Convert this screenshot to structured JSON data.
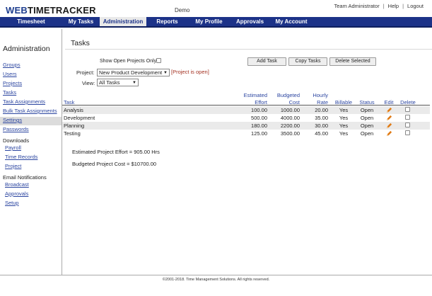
{
  "header": {
    "logo_web": "WEB",
    "logo_rest": "TIMETRACKER",
    "demo": "Demo",
    "links": [
      "Team Administrator",
      "Help",
      "Logout"
    ],
    "separator": "|"
  },
  "nav": {
    "tabs": [
      {
        "label": "Timesheet",
        "active": false
      },
      {
        "label": "My Tasks",
        "active": false
      },
      {
        "label": "Administration",
        "active": true
      },
      {
        "label": "Reports",
        "active": false
      },
      {
        "label": "My Profile",
        "active": false
      },
      {
        "label": "Approvals",
        "active": false
      },
      {
        "label": "My Account",
        "active": false
      }
    ]
  },
  "sidebar": {
    "title": "Administration",
    "items": [
      "Groups",
      "Users",
      "Projects",
      "Tasks",
      "Task Assignments",
      "Bulk Task Assignments",
      "Settings",
      "Passwords"
    ],
    "active": "Tasks",
    "downloads_heading": "Downloads",
    "downloads": [
      "Payroll",
      "Time Records",
      "Project"
    ],
    "email_heading": "Email Notifications",
    "email": [
      "Broadcast",
      "Approvals",
      "Setup"
    ]
  },
  "main": {
    "title": "Tasks",
    "show_open_label": "Show Open Projects Only:",
    "buttons": {
      "add": "Add Task",
      "copy": "Copy Tasks",
      "delete": "Delete Selected"
    },
    "project_label": "Project:",
    "project_value": "New Product Development",
    "project_status": "[Project is open]",
    "view_label": "View:",
    "view_value": "All Tasks"
  },
  "table": {
    "headers": {
      "task": "Task",
      "effort_1": "Estimated",
      "effort_2": "Effort",
      "cost_1": "Budgeted",
      "cost_2": "Cost",
      "rate_1": "Hourly",
      "rate_2": "Rate",
      "billable": "Billable",
      "status": "Status",
      "edit": "Edit",
      "delete": "Delete"
    },
    "rows": [
      {
        "task": "Analysis",
        "effort": "100.00",
        "cost": "1000.00",
        "rate": "20.00",
        "billable": "Yes",
        "status": "Open"
      },
      {
        "task": "Development",
        "effort": "500.00",
        "cost": "4000.00",
        "rate": "35.00",
        "billable": "Yes",
        "status": "Open"
      },
      {
        "task": "Planning",
        "effort": "180.00",
        "cost": "2200.00",
        "rate": "30.00",
        "billable": "Yes",
        "status": "Open"
      },
      {
        "task": "Testing",
        "effort": "125.00",
        "cost": "3500.00",
        "rate": "45.00",
        "billable": "Yes",
        "status": "Open"
      }
    ]
  },
  "summary": {
    "effort": "Estimated Project Effort = 905.00 Hrs",
    "cost": "Budgeted Project Cost = $10700.00"
  },
  "footer": {
    "copyright": "©2001-2018. Time Management Solutions. All rights reserved."
  },
  "colors": {
    "nav_bg": "#1c3288",
    "link": "#2b45a0",
    "status_red": "#a33020",
    "pencil": "#e07b16"
  },
  "icons": {
    "edit": "pencil-icon",
    "dropdown": "chevron-down-icon"
  }
}
